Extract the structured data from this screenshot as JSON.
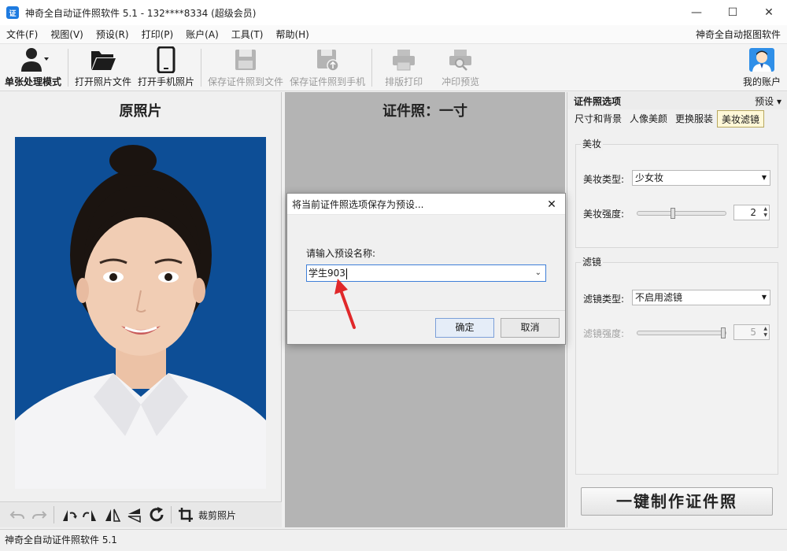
{
  "window": {
    "title": "神奇全自动证件照软件 5.1 - 132****8334 (超级会员)",
    "app_icon_text": "证",
    "minimize": "—",
    "maximize": "☐",
    "close": "✕"
  },
  "menu": {
    "items": [
      "文件(F)",
      "视图(V)",
      "预设(R)",
      "打印(P)",
      "账户(A)",
      "工具(T)",
      "帮助(H)"
    ],
    "right_link": "神奇全自动抠图软件"
  },
  "toolbar": {
    "single_mode": "单张处理模式",
    "open_file": "打开照片文件",
    "open_phone": "打开手机照片",
    "save_file": "保存证件照到文件",
    "save_phone": "保存证件照到手机",
    "layout_print": "排版打印",
    "print_preview": "冲印预览",
    "my_account": "我的账户"
  },
  "left": {
    "title": "原照片",
    "crop_label": "裁剪照片"
  },
  "middle": {
    "title": "证件照：一寸"
  },
  "right": {
    "header": "证件照选项",
    "preset": "预设 ▾",
    "tabs": [
      "尺寸和背景",
      "人像美颜",
      "更换服装",
      "美妆滤镜"
    ],
    "makeup": {
      "group_title": "美妆",
      "type_label": "美妆类型:",
      "type_value": "少女妆",
      "strength_label": "美妆强度:",
      "strength_value": "2",
      "strength_fraction": 0.4
    },
    "filter": {
      "group_title": "滤镜",
      "type_label": "滤镜类型:",
      "type_value": "不启用滤镜",
      "strength_label": "滤镜强度:",
      "strength_value": "5",
      "strength_fraction": 1.0
    },
    "make_button": "一键制作证件照"
  },
  "dialog": {
    "title": "将当前证件照选项保存为预设...",
    "close": "✕",
    "prompt": "请输入预设名称:",
    "input_value": "学生903",
    "ok": "确定",
    "cancel": "取消"
  },
  "status": {
    "text": "神奇全自动证件照软件 5.1"
  },
  "colors": {
    "photo_background": "#0d4e96",
    "annotation_arrow": "#e0282a"
  }
}
